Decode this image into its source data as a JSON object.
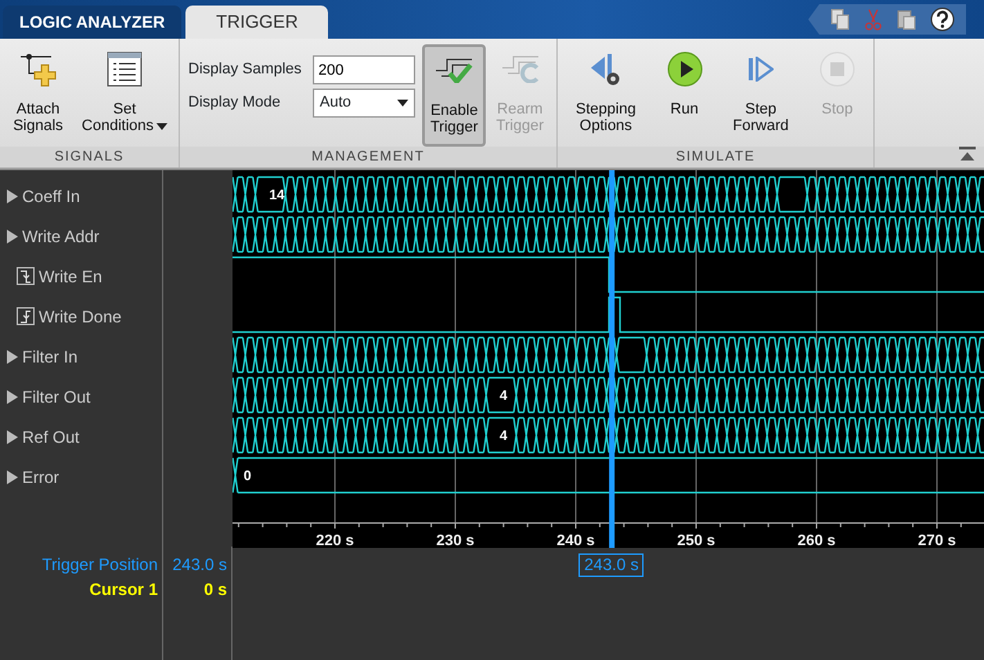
{
  "tabs": [
    {
      "label": "LOGIC ANALYZER",
      "selected": false
    },
    {
      "label": "TRIGGER",
      "selected": true
    }
  ],
  "ribbon": {
    "sections": [
      {
        "title": "SIGNALS",
        "items": [
          {
            "kind": "button",
            "label": [
              "Attach",
              "Signals"
            ],
            "disabled": false
          },
          {
            "kind": "menu",
            "label": [
              "Set",
              "Conditions"
            ],
            "disabled": false
          }
        ]
      },
      {
        "title": "MANAGEMENT",
        "items": [
          {
            "kind": "fields",
            "fields": [
              {
                "label": "Display Samples",
                "kind": "text",
                "value": "200"
              },
              {
                "label": "Display Mode",
                "kind": "select",
                "value": "Auto"
              }
            ]
          },
          {
            "kind": "toggle",
            "label": [
              "Enable",
              "Trigger"
            ],
            "on": true,
            "disabled": false
          },
          {
            "kind": "button",
            "label": [
              "Rearm",
              "Trigger"
            ],
            "disabled": true
          }
        ]
      },
      {
        "title": "SIMULATE",
        "items": [
          {
            "kind": "button",
            "label": [
              "Stepping",
              "Options"
            ],
            "disabled": false
          },
          {
            "kind": "button",
            "label": [
              "Run"
            ],
            "disabled": false
          },
          {
            "kind": "button",
            "label": [
              "Step",
              "Forward"
            ],
            "disabled": false
          },
          {
            "kind": "button",
            "label": [
              "Stop"
            ],
            "disabled": true
          }
        ]
      }
    ]
  },
  "signals": [
    {
      "name": "Coeff In",
      "kind": "bus",
      "value": "14"
    },
    {
      "name": "Write Addr",
      "kind": "bus"
    },
    {
      "name": "Write En",
      "kind": "bit"
    },
    {
      "name": "Write Done",
      "kind": "bit"
    },
    {
      "name": "Filter In",
      "kind": "bus"
    },
    {
      "name": "Filter Out",
      "kind": "bus",
      "value": "4"
    },
    {
      "name": "Ref Out",
      "kind": "bus",
      "value": "4"
    },
    {
      "name": "Error",
      "kind": "bus",
      "value": "0"
    }
  ],
  "time_axis": {
    "ticks": [
      "220 s",
      "230 s",
      "240 s",
      "250 s",
      "260 s",
      "270 s"
    ]
  },
  "trigger_marker": {
    "label": "243.0 s"
  },
  "cursors": [
    {
      "label": "Trigger Position",
      "value": "243.0 s",
      "color": "#1e9bff"
    },
    {
      "label": "Cursor 1",
      "value": "0 s",
      "color": "#ffff00"
    }
  ]
}
